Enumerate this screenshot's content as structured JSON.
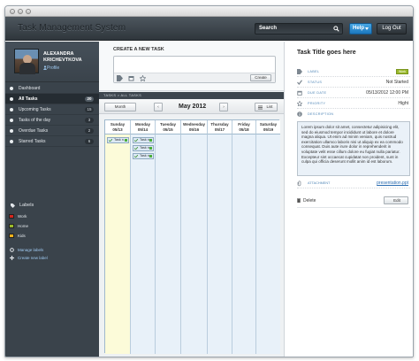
{
  "app": {
    "title": "Task Management System"
  },
  "header": {
    "search_label": "Search",
    "help_label": "Help",
    "logout_label": "Log Out"
  },
  "user": {
    "name_line1": "ALEXANDRA",
    "name_line2": "KRICHEVTKOVA",
    "profile_link": "Profile"
  },
  "sidebar": {
    "items": [
      {
        "label": "Dashboard",
        "count": ""
      },
      {
        "label": "All Tasks",
        "count": "20"
      },
      {
        "label": "Upcoming Tasks",
        "count": "15"
      },
      {
        "label": "Tasks of the day",
        "count": "3"
      },
      {
        "label": "Overdue Tasks",
        "count": "2"
      },
      {
        "label": "Starred Tasks",
        "count": "6"
      }
    ],
    "labels_title": "Labels",
    "labels": [
      {
        "name": "Work",
        "color": "#d6261d"
      },
      {
        "name": "Home",
        "color": "#9ab92a"
      },
      {
        "name": "Kids",
        "color": "#f2b21b"
      }
    ],
    "manage_labels": "Manage labels",
    "create_label": "Create new label"
  },
  "create": {
    "title": "CREATE A NEW TASK",
    "button": "Create"
  },
  "breadcrumb": "TASKS > ALL TASKS",
  "calendar": {
    "view_month": "Month",
    "prev": "‹",
    "month_title": "May 2012",
    "next": "›",
    "view_list": "List",
    "days": [
      {
        "name": "Sunday",
        "date": "05/13"
      },
      {
        "name": "Monday",
        "date": "05/14"
      },
      {
        "name": "Tuesday",
        "date": "05/15"
      },
      {
        "name": "Wednesday",
        "date": "05/16"
      },
      {
        "name": "Thursday",
        "date": "05/17"
      },
      {
        "name": "Friday",
        "date": "05/18"
      },
      {
        "name": "Saturday",
        "date": "05/19"
      }
    ],
    "task_label": "Task n..."
  },
  "detail": {
    "title": "Task Title goes here",
    "label_key": "LABEL",
    "label_value": "Work",
    "status_key": "STATUS",
    "status_value": "Not Started",
    "due_key": "DUE DATE",
    "due_value": "05/13/2012 12:00 PM",
    "priority_key": "PRIORITY",
    "priority_value": "Hight",
    "description_key": "DESCRIPTION",
    "description": "Lorem ipsum dolor sit amet, consectetur adipisicing elit, sed do eiusmod tempor incididunt ut labore et dolore magna aliqua. Ut enim ad minim veniam, quis nostrud exercitation ullamco laboris nisi ut aliquip ex ea commodo consequat. Duis aute irure dolor in reprehenderit in voluptate velit esse cillum dolore eu fugiat nulla pariatur. Excepteur sint occaecat cupidatat non proident, sunt in culpa qui officia deserunt mollit anim id est laborum.",
    "attachment_key": "ATTACHMENT",
    "attachment_value": "presentation.ppt",
    "delete_label": "Delete",
    "edit_label": "Edit"
  },
  "colors": {
    "accent": "#1b77bd",
    "sidebar": "#3a434b",
    "header": "#2f363c"
  }
}
